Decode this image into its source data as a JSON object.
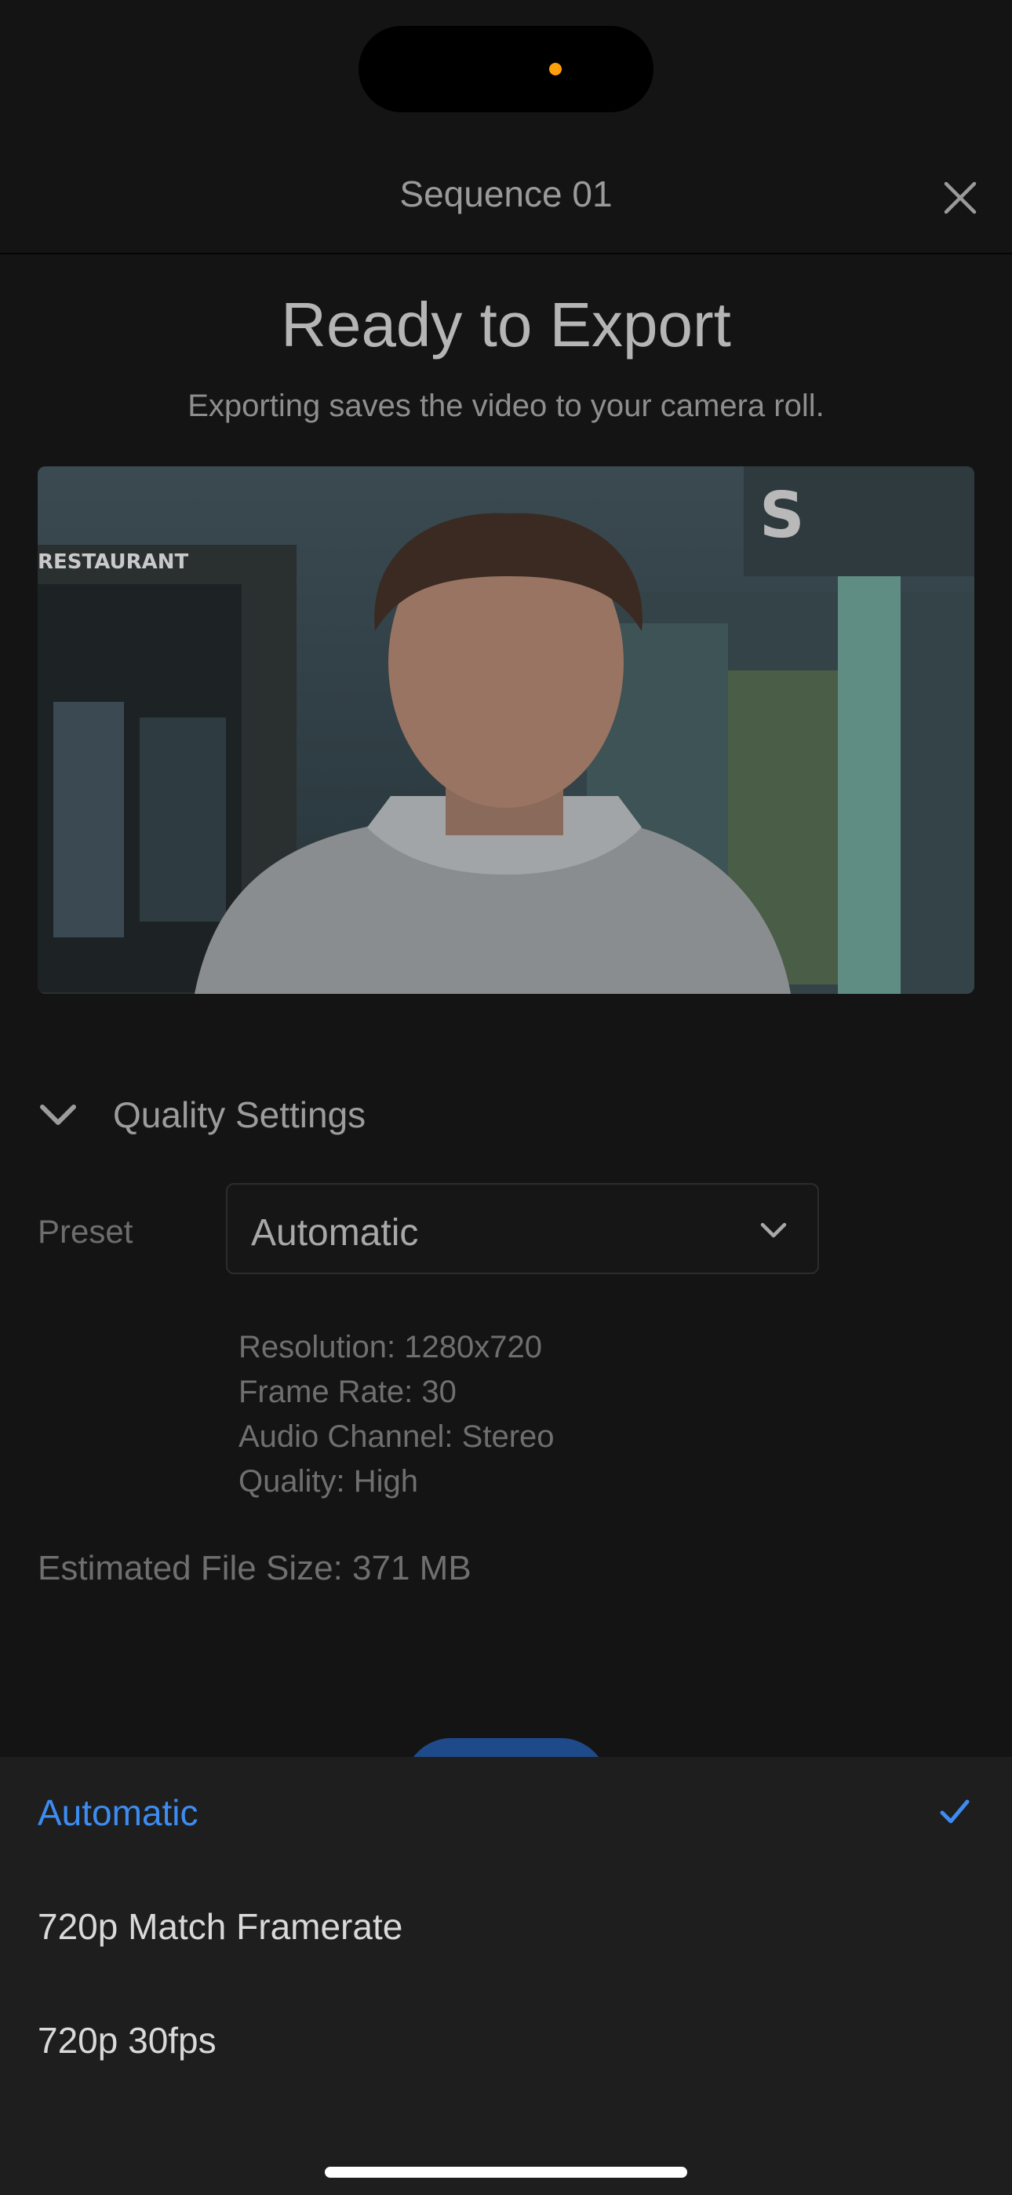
{
  "status": {
    "privacy_dot_color": "#ff9f0a"
  },
  "header": {
    "title": "Sequence 01",
    "close_icon": "close-icon"
  },
  "main": {
    "title": "Ready to Export",
    "subtitle": "Exporting saves the video to your camera roll.",
    "preview": {
      "sign_text": "RESTAURANT",
      "logo_letter": "S",
      "description_icon": "video-thumbnail"
    }
  },
  "quality": {
    "section_label": "Quality Settings",
    "preset_label": "Preset",
    "preset_value": "Automatic",
    "specs": {
      "resolution": "Resolution: 1280x720",
      "frame_rate": "Frame Rate: 30",
      "audio_channel": "Audio Channel: Stereo",
      "quality": "Quality: High"
    },
    "estimated_size": "Estimated File Size: 371 MB"
  },
  "sheet": {
    "options": [
      {
        "label": "Automatic",
        "selected": true
      },
      {
        "label": "720p Match Framerate",
        "selected": false
      },
      {
        "label": "720p 30fps",
        "selected": false
      }
    ],
    "accent_color": "#3d8cf2"
  }
}
